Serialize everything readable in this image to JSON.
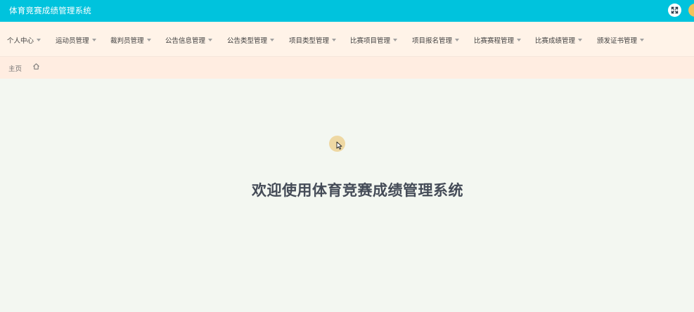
{
  "header": {
    "title": "体育竞赛成绩管理系统",
    "fullscreen_icon": "fullscreen-toggle-icon",
    "avatar_icon": "user-avatar",
    "accent_color": "#00c3dd"
  },
  "menu": {
    "items": [
      {
        "label": "个人中心"
      },
      {
        "label": "运动员管理"
      },
      {
        "label": "裁判员管理"
      },
      {
        "label": "公告信息管理"
      },
      {
        "label": "公告类型管理"
      },
      {
        "label": "项目类型管理"
      },
      {
        "label": "比赛项目管理"
      },
      {
        "label": "项目报名管理"
      },
      {
        "label": "比赛赛程管理"
      },
      {
        "label": "比赛成绩管理"
      },
      {
        "label": "颁发证书管理"
      }
    ],
    "dropdown_icon": "caret-down-icon"
  },
  "breadcrumb": {
    "home_label": "主页",
    "home_icon": "home-icon"
  },
  "main": {
    "welcome_text": "欢迎使用体育竞赛成绩管理系统"
  }
}
